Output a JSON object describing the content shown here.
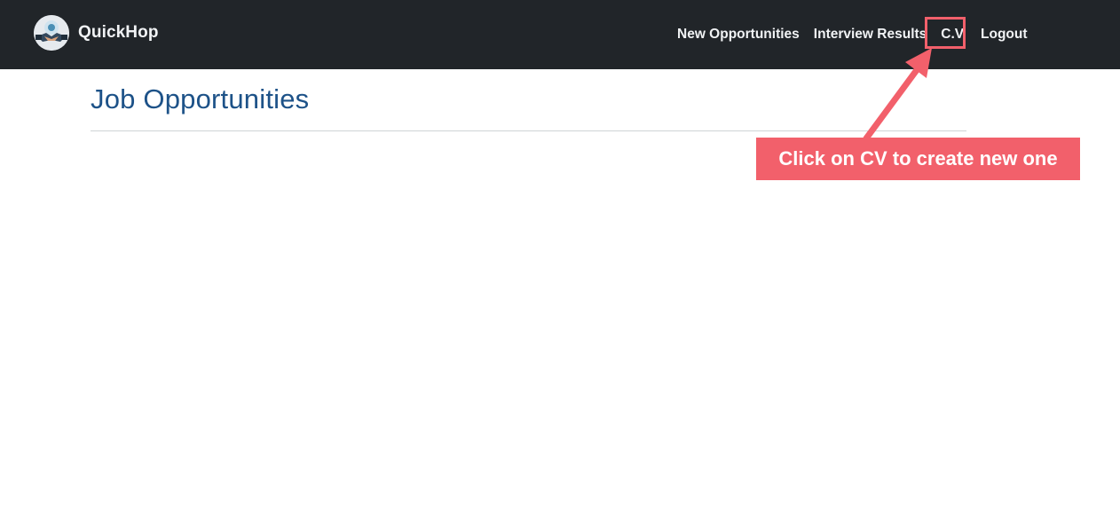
{
  "brand": {
    "name": "QuickHop",
    "logo_icon": "handshake-logo-icon"
  },
  "nav": {
    "items": [
      {
        "label": "New Opportunities"
      },
      {
        "label": "Interview Results"
      },
      {
        "label": "C.V."
      },
      {
        "label": "Logout"
      }
    ]
  },
  "main": {
    "title": "Job Opportunities"
  },
  "annotation": {
    "text": "Click on CV to create new one",
    "color": "#f2606b",
    "arrow_icon": "arrow-icon"
  },
  "colors": {
    "navbar": "#212529",
    "title": "#1d5288",
    "annotation": "#f2606b"
  }
}
